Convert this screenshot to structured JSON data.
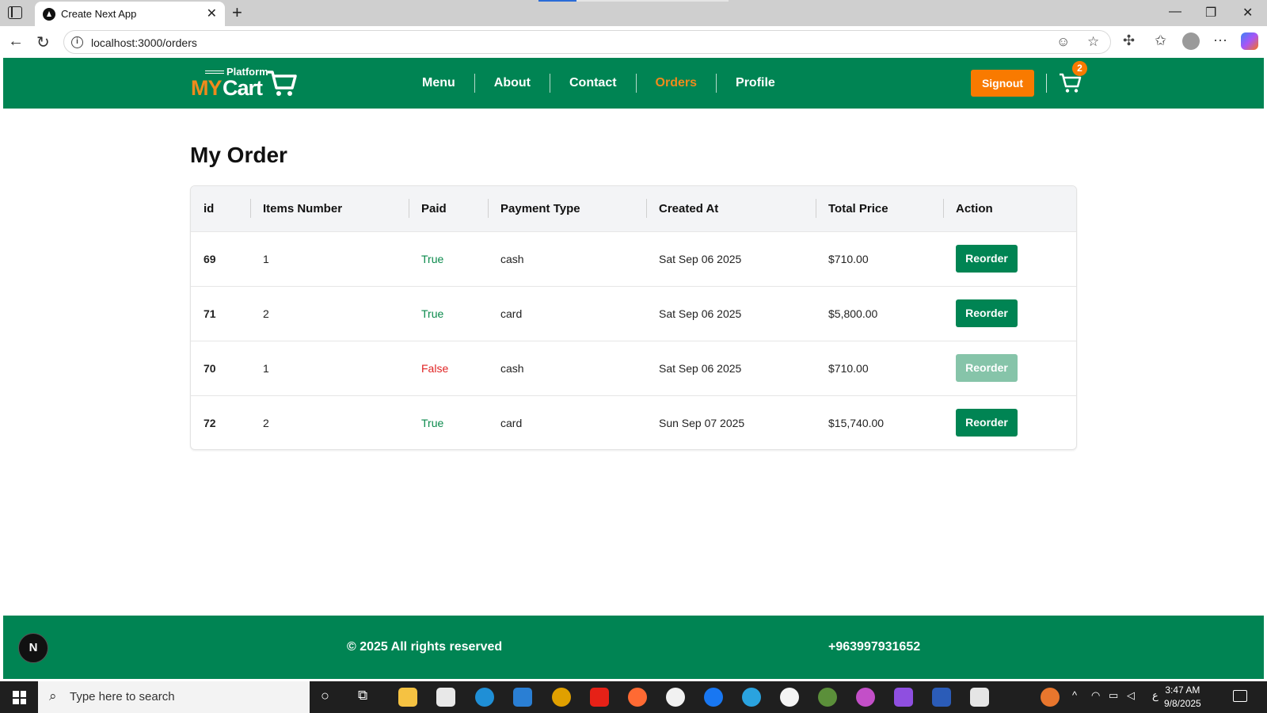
{
  "browser": {
    "tab_title": "Create Next App",
    "url": "localhost:3000/orders"
  },
  "header": {
    "logo_small": "Platform",
    "logo_my": "MY",
    "logo_cart": "Cart",
    "nav": [
      {
        "label": "Menu",
        "active": false
      },
      {
        "label": "About",
        "active": false
      },
      {
        "label": "Contact",
        "active": false
      },
      {
        "label": "Orders",
        "active": true
      },
      {
        "label": "Profile",
        "active": false
      }
    ],
    "signout_label": "Signout",
    "cart_count": "2"
  },
  "main": {
    "title": "My Order",
    "columns": [
      "id",
      "Items Number",
      "Paid",
      "Payment Type",
      "Created At",
      "Total Price",
      "Action"
    ],
    "rows": [
      {
        "id": "69",
        "items": "1",
        "paid": "True",
        "payment": "cash",
        "created": "Sat Sep 06 2025",
        "total": "$710.00",
        "action": "Reorder",
        "enabled": true
      },
      {
        "id": "71",
        "items": "2",
        "paid": "True",
        "payment": "card",
        "created": "Sat Sep 06 2025",
        "total": "$5,800.00",
        "action": "Reorder",
        "enabled": true
      },
      {
        "id": "70",
        "items": "1",
        "paid": "False",
        "payment": "cash",
        "created": "Sat Sep 06 2025",
        "total": "$710.00",
        "action": "Reorder",
        "enabled": false
      },
      {
        "id": "72",
        "items": "2",
        "paid": "True",
        "payment": "card",
        "created": "Sun Sep 07 2025",
        "total": "$15,740.00",
        "action": "Reorder",
        "enabled": true
      }
    ]
  },
  "footer": {
    "badge": "N",
    "copyright": "© 2025 All rights reserved",
    "phone": "+963997931652"
  },
  "taskbar": {
    "search_placeholder": "Type here to search",
    "time": "3:47 AM",
    "date": "9/8/2025",
    "lang": "ع"
  },
  "colors": {
    "brand_green": "#008453",
    "accent_orange": "#f97a00",
    "paid_true": "#0b8a4c",
    "paid_false": "#e02424"
  }
}
